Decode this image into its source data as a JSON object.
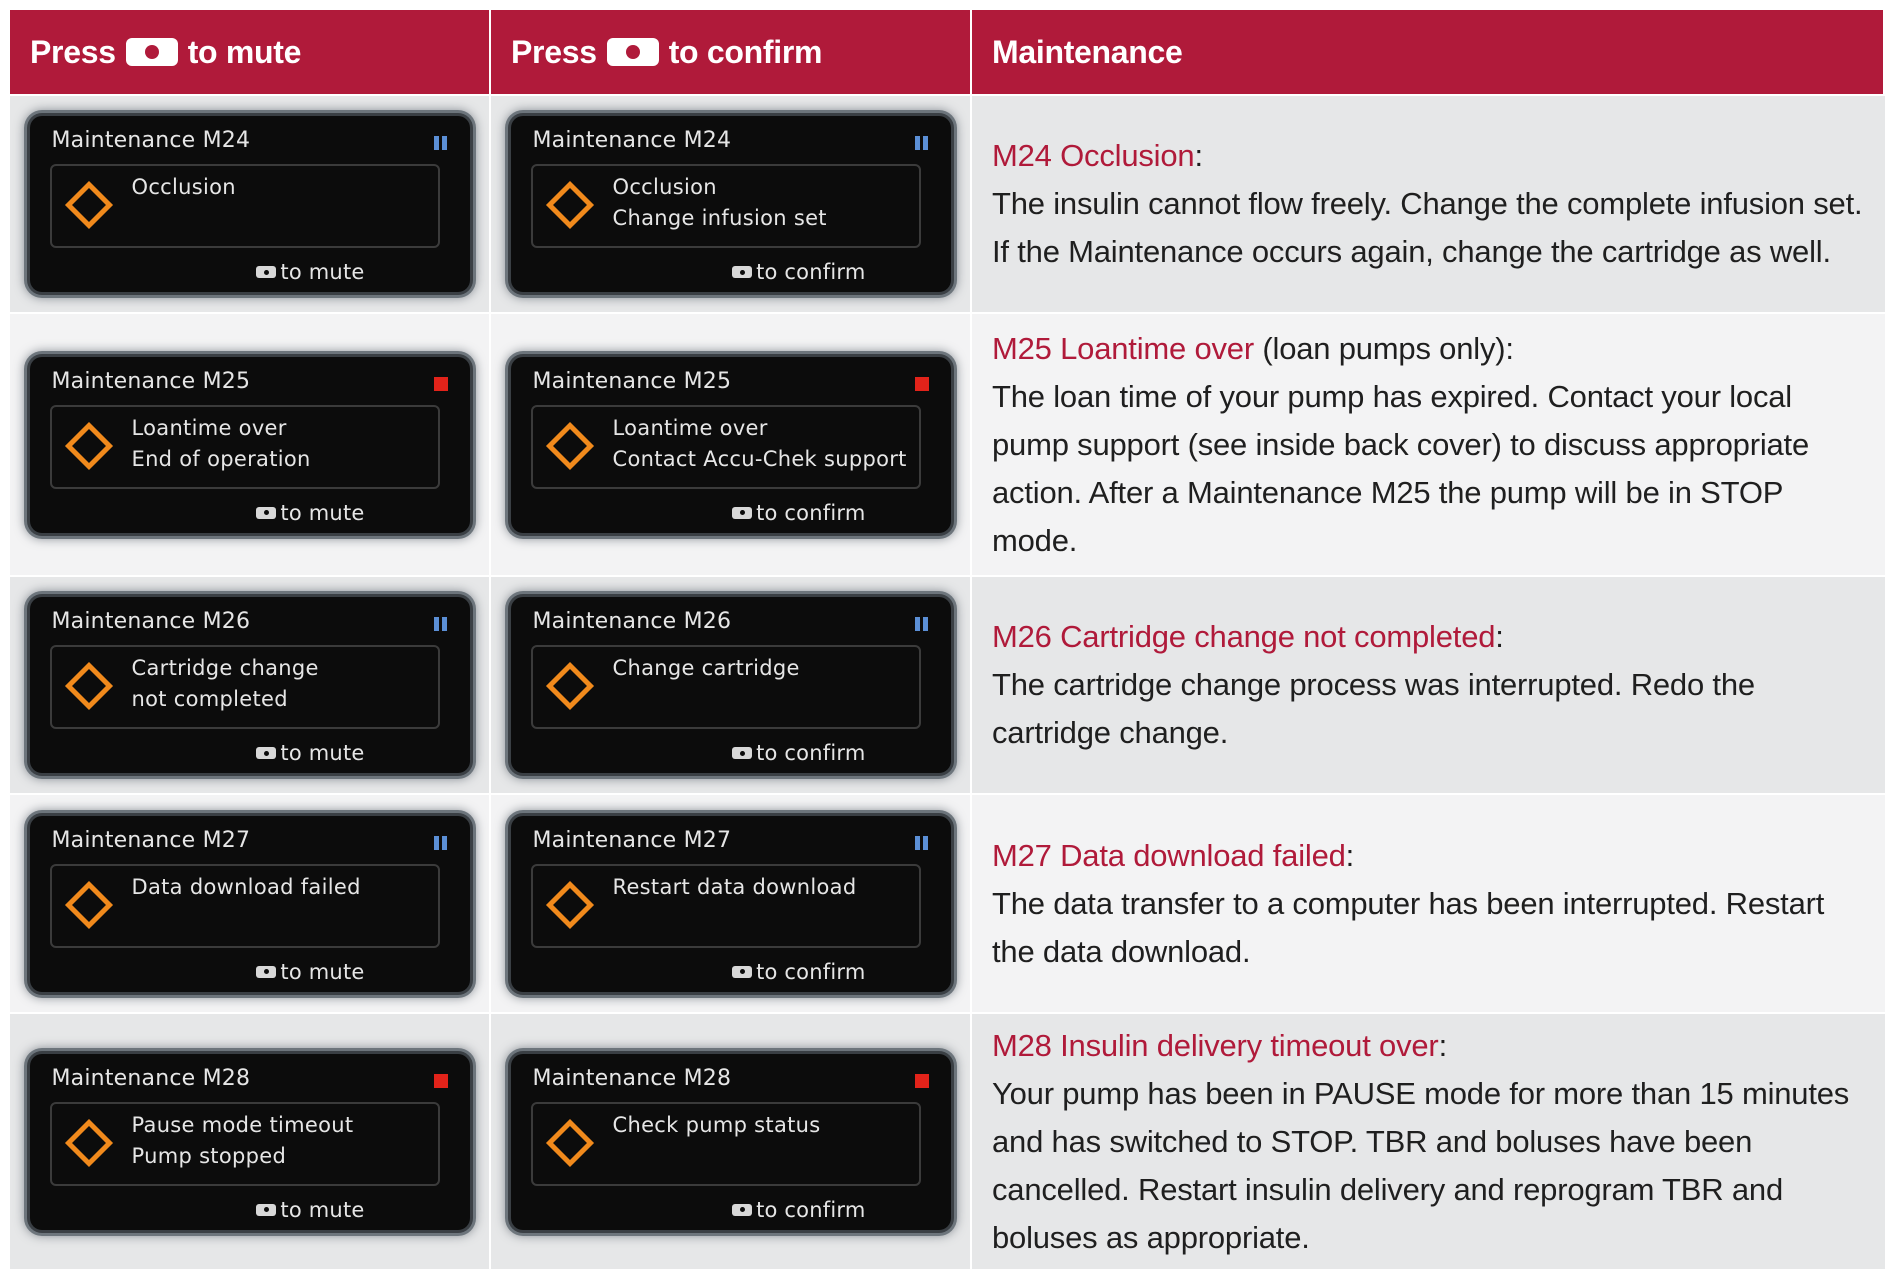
{
  "header": {
    "col1_prefix": "Press",
    "col1_suffix": "to mute",
    "col2_prefix": "Press",
    "col2_suffix": "to confirm",
    "col3": "Maintenance"
  },
  "colors": {
    "brand_red": "#b01a3a",
    "warning_orange": "#f18a1c",
    "pause_blue": "#5b8fd6",
    "stop_red": "#e2231a"
  },
  "rows": [
    {
      "screen_title": "Maintenance M24",
      "status_icon": "pause-icon",
      "mute_lines": [
        "Occlusion",
        ""
      ],
      "confirm_lines": [
        "Occlusion",
        "Change infusion set"
      ],
      "mute_footer": "to mute",
      "confirm_footer": "to confirm",
      "desc_title": "M24 Occlusion",
      "desc_title_suffix": ":",
      "desc_body": "The insulin cannot flow freely. Change the complete infusion set. If the Maintenance occurs again, change the cartridge as well."
    },
    {
      "screen_title": "Maintenance M25",
      "status_icon": "stop-icon",
      "mute_lines": [
        "Loantime over",
        "End of operation"
      ],
      "confirm_lines": [
        "Loantime over",
        "Contact Accu-Chek support"
      ],
      "mute_footer": "to mute",
      "confirm_footer": "to confirm",
      "desc_title": "M25 Loantime over",
      "desc_title_suffix": " (loan pumps only):",
      "desc_body": "The loan time of your pump has expired. Contact your local pump support (see inside back cover) to discuss appropriate action. After a Maintenance M25 the pump will be in STOP mode."
    },
    {
      "screen_title": "Maintenance M26",
      "status_icon": "pause-icon",
      "mute_lines": [
        "Cartridge change",
        "not completed"
      ],
      "confirm_lines": [
        "Change cartridge",
        ""
      ],
      "mute_footer": "to mute",
      "confirm_footer": "to confirm",
      "desc_title": "M26 Cartridge change not completed",
      "desc_title_suffix": ":",
      "desc_body": "The cartridge change process was interrupted. Redo the cartridge change."
    },
    {
      "screen_title": "Maintenance M27",
      "status_icon": "pause-icon",
      "mute_lines": [
        "Data download failed",
        ""
      ],
      "confirm_lines": [
        "Restart data download",
        ""
      ],
      "mute_footer": "to mute",
      "confirm_footer": "to confirm",
      "desc_title": "M27 Data download failed",
      "desc_title_suffix": ":",
      "desc_body": "The data transfer to a computer has been interrupted. Restart the data download."
    },
    {
      "screen_title": "Maintenance M28",
      "status_icon": "stop-icon",
      "mute_lines": [
        "Pause mode timeout",
        "Pump stopped"
      ],
      "confirm_lines": [
        "Check pump status",
        ""
      ],
      "mute_footer": "to mute",
      "confirm_footer": "to confirm",
      "desc_title": "M28 Insulin delivery timeout over",
      "desc_title_suffix": ":",
      "desc_body": "Your pump has been in PAUSE mode for more than 15 minutes and has switched to STOP. TBR and boluses have been cancelled. Restart insulin delivery and reprogram TBR and boluses as appropriate."
    }
  ]
}
